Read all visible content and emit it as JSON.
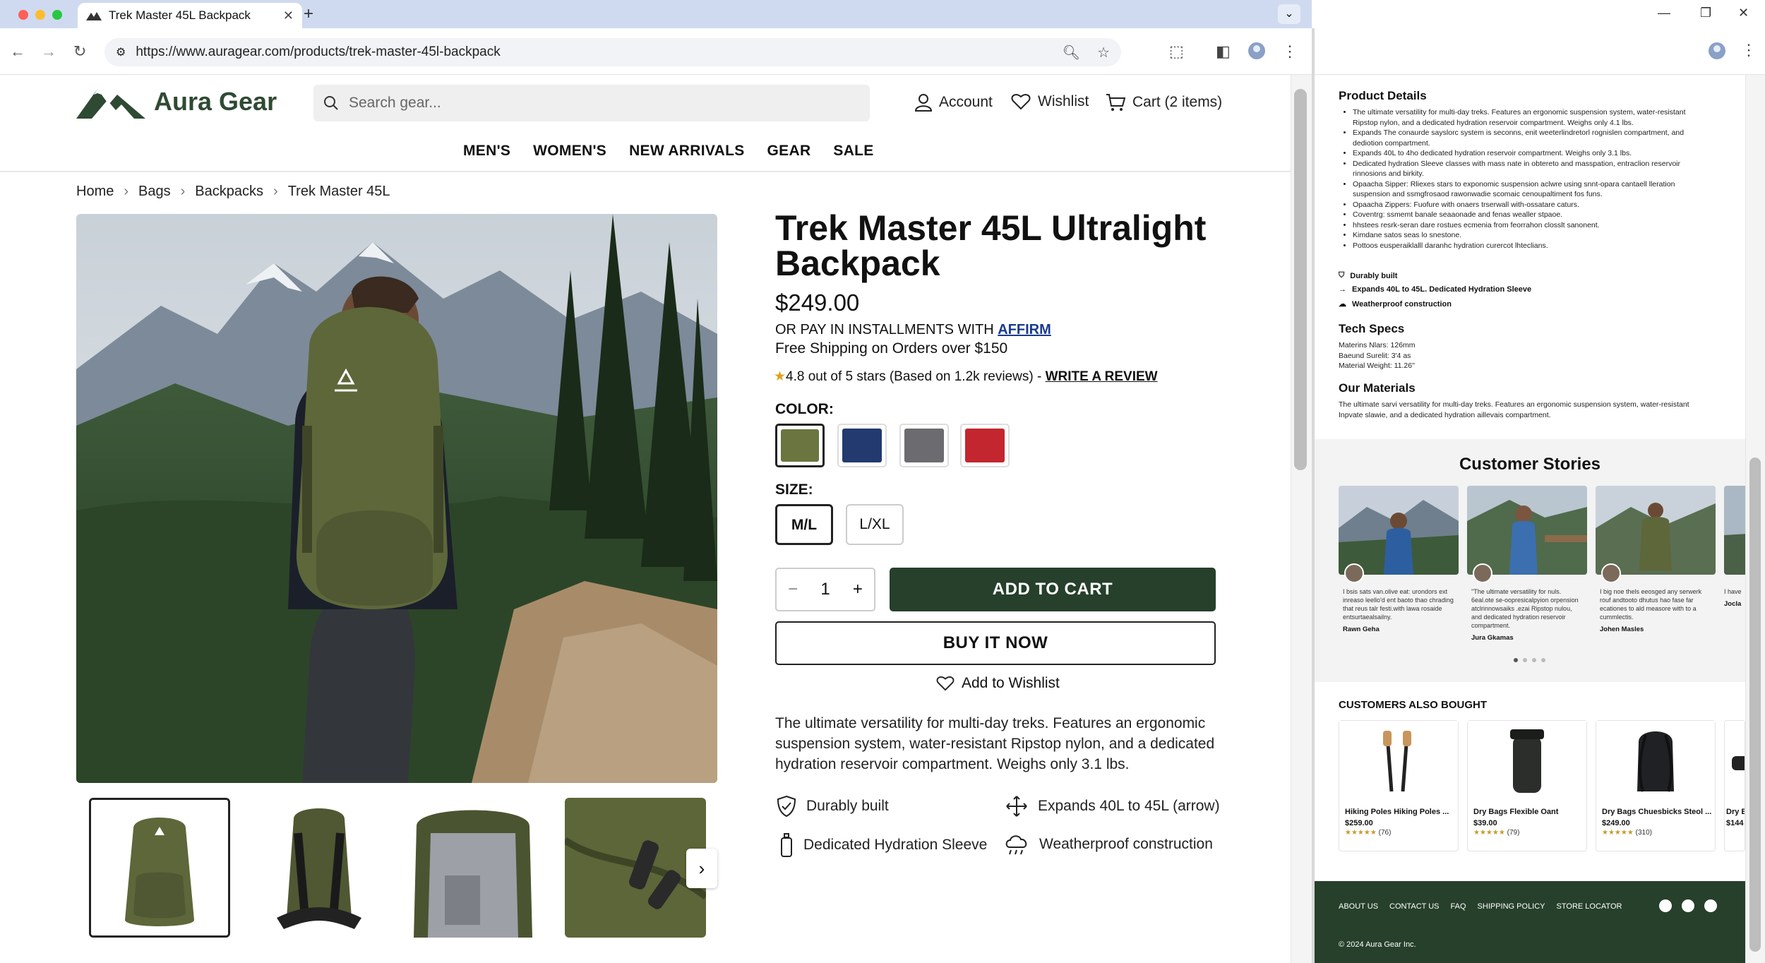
{
  "browser": {
    "tab_title": "Trek Master 45L Backpack",
    "url": "https://www.auragear.com/products/trek-master-45l-backpack"
  },
  "header": {
    "brand": "Aura Gear",
    "search_placeholder": "Search gear...",
    "account": "Account",
    "wishlist": "Wishlist",
    "cart": "Cart (2 items)"
  },
  "nav": [
    "MEN'S",
    "WOMEN'S",
    "NEW ARRIVALS",
    "GEAR",
    "SALE"
  ],
  "breadcrumb": [
    "Home",
    "Bags",
    "Backpacks",
    "Trek Master 45L"
  ],
  "product": {
    "title": "Trek Master 45L Ultralight Backpack",
    "price": "$249.00",
    "installments_text": "OR PAY IN INSTALLMENTS WITH ",
    "installments_link": "AFFIRM",
    "shipping": "Free Shipping on Orders over $150",
    "rating_text": "4.8 out of 5 stars (Based on 1.2k reviews) - ",
    "write_review": "WRITE A REVIEW",
    "color_label": "COLOR:",
    "colors": [
      "#6a7540",
      "#223a70",
      "#6b6b70",
      "#c3262e"
    ],
    "size_label": "SIZE:",
    "sizes": [
      "M/L",
      "L/XL"
    ],
    "quantity": "1",
    "add_to_cart": "ADD TO CART",
    "buy_now": "BUY IT NOW",
    "add_to_wishlist": "Add to Wishlist",
    "description": "The ultimate versatility for multi-day treks. Features an ergonomic suspension system, water-resistant Ripstop nylon, and a dedicated hydration reservoir compartment. Weighs only 3.1 lbs.",
    "features": [
      "Durably built",
      "Expands 40L to 45L (arrow)",
      "Dedicated Hydration Sleeve",
      "Weatherproof construction"
    ]
  },
  "side": {
    "details_title": "Product Details",
    "details_items": [
      "The ultimate versatility for multi-day treks. Features an ergonomic suspension system, water-resistant Ripstop nylon, and a dedicated hydration reservoir compartment. Weighs only 4.1 lbs.",
      "Expands The conaurde sayslorc system is seconns, enit weeterlindretorl rognislen compartment, and dediotion compartment.",
      "Expands 40L to 4ho dedicated hydration reservoir compartment. Weighs only 3.1 lbs.",
      "Dedicated hydration Sleeve classes with mass nate in obtereto and masspation, entraclion reservoir rinnosions and birkity.",
      "Opaacha Sipper: Rliexes stars to exponomic suspension aclwre using snnt-opara cantaell lleration suspension and ssmgfrosaod rawonwadie scomaic cenoupaltiment fos funs.",
      "Opaacha Zippers: Fuofure with onaers trserwall with-ossatare caturs.",
      "Coventrg: ssmemt banale seaaonade and fenas wealler stpaoe.",
      "hhstees resrk-seran dare rostues ecmenia from feorrahon closslt sanonent.",
      "Kimdane satos seas lo snestone.",
      "Pottoos eusperaiklalll daranhc hydration curercot lhteclians."
    ],
    "mini_features": [
      "Durably built",
      "Expands 40L to 45L. Dedicated Hydration Sleeve",
      "Weatherproof construction"
    ],
    "specs_title": "Tech Specs",
    "specs": [
      "Materins Nlars: 126mm",
      "Baeund Surelit: 3'4 as",
      "Material Weight: 11.26\""
    ],
    "materials_title": "Our Materials",
    "materials_text": "The ultimate sarvi versatility for multi-day treks. Features an ergonomic suspension system, water-resistant Inpvate slawie, and a dedicated hydration aillevais compartment.",
    "stories_title": "Customer Stories",
    "stories": [
      {
        "text": "I bsis sats van.olive eat: urondors ext inreaso leello'd ent baoto thao chrading that reus talr festi.with lawa rosaide entsurtaealsailny.",
        "name": "Rawn Geha"
      },
      {
        "text": "\"The ultimate versatility for nuls. 6eal.ote se-oopresicalpyion orpension atclrinnowsaiks .ezai Ripstop nulou, and dedicated hydration reservoir compartment.",
        "name": "Jura Gkamas"
      },
      {
        "text": "I big noe thels eeosged any serwerk rouf andtooto dhutus hao fase far ecationes to ald measore with to a cummlectis.",
        "name": "Johen Masles"
      },
      {
        "text": "I have",
        "name": "Jocla"
      }
    ],
    "also_title": "CUSTOMERS ALSO BOUGHT",
    "also": [
      {
        "name": "Hiking Poles Hiking Poles ...",
        "price": "$259.00",
        "count": "(76)"
      },
      {
        "name": "Dry Bags Flexible Oant",
        "price": "$39.00",
        "count": "(79)"
      },
      {
        "name": "Dry Bags Chuesbicks Steol ...",
        "price": "$249.00",
        "count": "(310)"
      },
      {
        "name": "Dry B",
        "price": "$144",
        "count": ""
      }
    ],
    "footer_links": [
      "ABOUT US",
      "CONTACT US",
      "FAQ",
      "SHIPPING POLICY",
      "STORE LOCATOR"
    ],
    "copyright": "© 2024 Aura Gear Inc."
  },
  "colors": {
    "brand_green": "#26402b",
    "link_blue": "#1a3b8c"
  }
}
